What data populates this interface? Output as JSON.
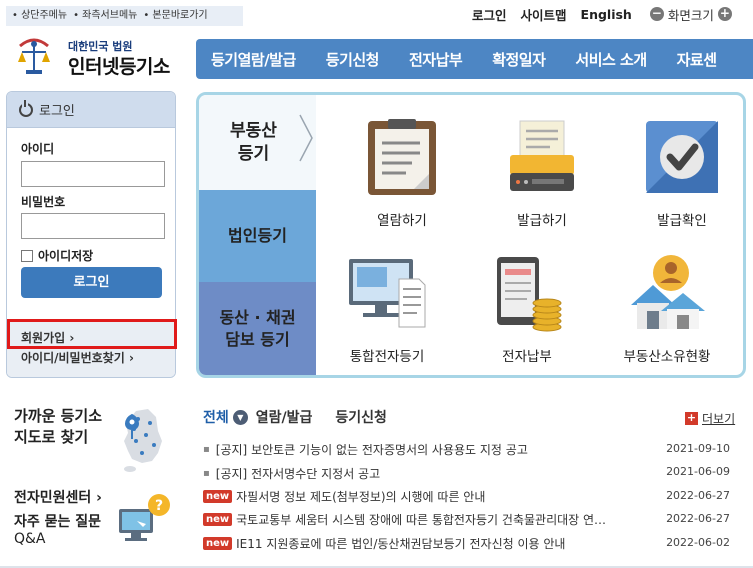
{
  "skip_links": [
    "• 상단주메뉴",
    "• 좌측서브메뉴",
    "• 본문바로가기"
  ],
  "top_links": {
    "login": "로그인",
    "sitemap": "사이트맵",
    "english": "English",
    "zoom": "화면크기"
  },
  "zoom_minus": "−",
  "zoom_plus": "+",
  "logo": {
    "line1": "대한민국 법원",
    "line2": "인터넷등기소"
  },
  "gnb": [
    "등기열람/발급",
    "등기신청",
    "전자납부",
    "확정일자",
    "서비스 소개",
    "자료센"
  ],
  "login": {
    "title": "로그인",
    "id_label": "아이디",
    "pw_label": "비밀번호",
    "id_value": "",
    "pw_value": "",
    "save_id": "아이디저장",
    "button": "로그인",
    "join": "회원가입",
    "find": "아이디/비밀번호찾기"
  },
  "categories": {
    "real_estate": "부동산\n등기",
    "corporate": "법인등기",
    "movable": "동산 · 채권\n담보 등기"
  },
  "services": [
    {
      "label": "열람하기",
      "icon": "clipboard-icon"
    },
    {
      "label": "발급하기",
      "icon": "printer-icon"
    },
    {
      "label": "발급확인",
      "icon": "checkmark-icon"
    },
    {
      "label": "통합전자등기",
      "icon": "monitor-document-icon"
    },
    {
      "label": "전자납부",
      "icon": "tablet-coins-icon"
    },
    {
      "label": "부동산소유현황",
      "icon": "person-house-icon"
    }
  ],
  "left_links": {
    "find_office": "가까운 등기소\n지도로 찾기",
    "minwon": "전자민원센터",
    "faq_line1": "자주 묻는 질문",
    "faq_line2": "Q&A"
  },
  "arrow": "›",
  "notice_tabs": [
    "전체",
    "열람/발급",
    "등기신청"
  ],
  "tab_dropdown_glyph": "▼",
  "more_label": "더보기",
  "more_glyph": "+",
  "new_badge": "new",
  "bullet": "▪",
  "notices": [
    {
      "prefix": "[공지]",
      "title": "보안토큰 기능이 없는 전자증명서의 사용용도 지정 공고",
      "date": "2021-09-10",
      "is_new": false
    },
    {
      "prefix": "[공지]",
      "title": "전자서명수단 지정서 공고",
      "date": "2021-06-09",
      "is_new": false
    },
    {
      "prefix": "",
      "title": "자필서명 정보 제도(첨부정보)의 시행에 따른 안내",
      "date": "2022-06-27",
      "is_new": true
    },
    {
      "prefix": "",
      "title": "국토교통부 세움터 시스템 장애에 따른 통합전자등기 건축물관리대장 연…",
      "date": "2022-06-27",
      "is_new": true
    },
    {
      "prefix": "",
      "title": "IE11 지원종료에 따른 법인/동산채권담보등기 전자신청 이용 안내",
      "date": "2022-06-02",
      "is_new": true
    }
  ],
  "colors": {
    "gnb": "#4d86c4",
    "login_button": "#3c7abc",
    "highlight_box": "#e01a1a",
    "new_badge": "#d23a2a",
    "panel_border": "#a7d5e6"
  }
}
